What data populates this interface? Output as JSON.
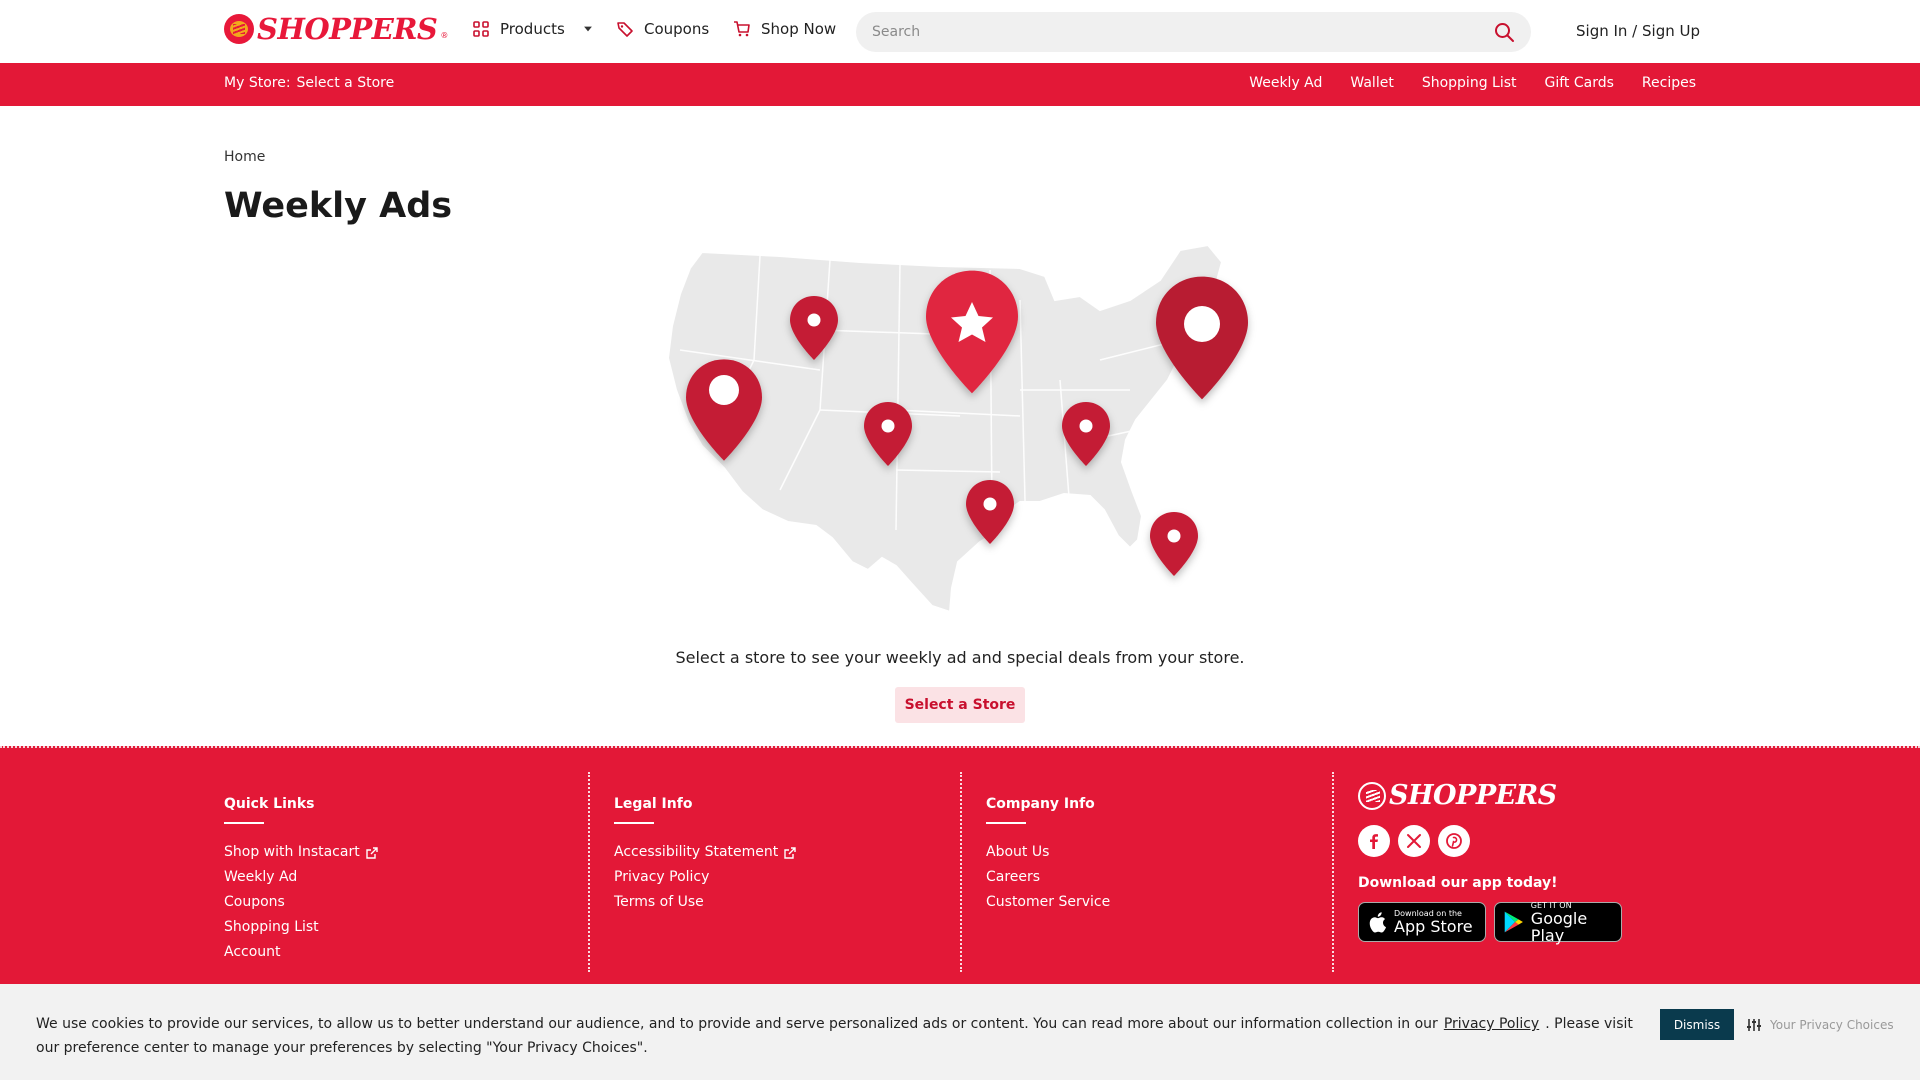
{
  "header": {
    "logo_text": "SHOPPERS",
    "nav": {
      "products": "Products",
      "coupons": "Coupons",
      "shop_now": "Shop Now"
    },
    "search_placeholder": "Search",
    "sign_in": "Sign In / Sign Up"
  },
  "store_bar": {
    "my_store_label": "My Store:",
    "store_value": "Select a Store",
    "links": [
      "Weekly Ad",
      "Wallet",
      "Shopping List",
      "Gift Cards",
      "Recipes"
    ]
  },
  "main": {
    "breadcrumb": "Home",
    "title": "Weekly Ads",
    "intro": "Select a store to see your weekly ad and special deals from your store.",
    "select_button": "Select a Store"
  },
  "footer": {
    "quick_links": {
      "title": "Quick Links",
      "items": [
        "Shop with Instacart",
        "Weekly Ad",
        "Coupons",
        "Shopping List",
        "Account"
      ]
    },
    "legal_info": {
      "title": "Legal Info",
      "items": [
        "Accessibility Statement",
        "Privacy Policy",
        "Terms of Use"
      ]
    },
    "company_info": {
      "title": "Company Info",
      "items": [
        "About Us",
        "Careers",
        "Customer Service"
      ]
    },
    "logo_text": "SHOPPERS",
    "social_icons": [
      "facebook-icon",
      "x-icon",
      "pinterest-icon"
    ],
    "download_title": "Download our app today!",
    "app_store": {
      "small": "Download on the",
      "big": "App Store"
    },
    "google_play": {
      "small": "GET IT ON",
      "big": "Google Play"
    }
  },
  "cookie": {
    "text_before": "We use cookies to provide our services, to allow us to better understand our audience, and to provide and serve personalized ads or content. You can read more about our information collection in our",
    "link": "Privacy Policy",
    "text_after": ". Please visit our preference center to manage your preferences by selecting \"Your Privacy Choices\".",
    "dismiss": "Dismiss",
    "privacy_choices": "Your Privacy Choices"
  },
  "colors": {
    "brand_red": "#e31837",
    "logo_gold": "#f2a81c",
    "dismiss_bg": "#0a3a4d",
    "button_pink_bg": "#fbe2e5"
  }
}
